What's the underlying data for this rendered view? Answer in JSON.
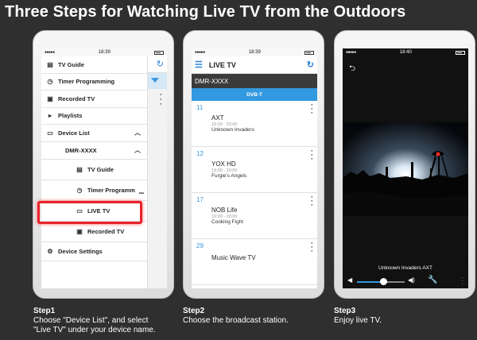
{
  "page_title": "Three Steps for Watching Live TV from the Outdoors",
  "phone1": {
    "time": "18:39",
    "menu": [
      {
        "label": "TV Guide",
        "icon": "tv-guide-icon"
      },
      {
        "label": "Timer Programming",
        "icon": "timer-icon"
      },
      {
        "label": "Recorded TV",
        "icon": "recorded-tv-icon"
      },
      {
        "label": "Playlists",
        "icon": "playlist-icon"
      },
      {
        "label": "Device List",
        "icon": "device-icon"
      },
      {
        "label": "DMR-XXXX"
      },
      {
        "label": "TV Guide",
        "icon": "tv-guide-icon"
      },
      {
        "label": "Timer Programm",
        "icon": "timer-icon"
      },
      {
        "label": "LIVE TV",
        "icon": "live-tv-icon"
      },
      {
        "label": "Recorded TV",
        "icon": "recorded-tv-icon"
      },
      {
        "label": "Device Settings",
        "icon": "settings-icon"
      }
    ],
    "colors": {
      "highlight": "#e8232a",
      "accent": "#3399e0"
    }
  },
  "phone2": {
    "time": "18:39",
    "app_title": "LIVE TV",
    "device": "DMR-XXXX",
    "tab": "DVB-T",
    "channels": [
      {
        "number": "11",
        "name": "AXT",
        "time": "19:00 - 20:00",
        "program": "Unknown Invaders"
      },
      {
        "number": "12",
        "name": "YOX HD",
        "time": "19:00 - 20:00",
        "program": "Furgie's Angels"
      },
      {
        "number": "17",
        "name": "NOB Life",
        "time": "19:00 - 20:00",
        "program": "Cooking Fight"
      },
      {
        "number": "29",
        "name": "Music Wave TV",
        "time": "",
        "program": ""
      }
    ]
  },
  "phone3": {
    "time": "18:40",
    "caption": "Unknown Invaders  AXT",
    "volume_level": 0.55
  },
  "steps": [
    {
      "heading": "Step1",
      "line1": "Choose \"Device List\", and select",
      "line2": "\"Live TV\" under your device name."
    },
    {
      "heading": "Step2",
      "line1": "Choose the broadcast station.",
      "line2": ""
    },
    {
      "heading": "Step3",
      "line1": "Enjoy live TV.",
      "line2": ""
    }
  ]
}
